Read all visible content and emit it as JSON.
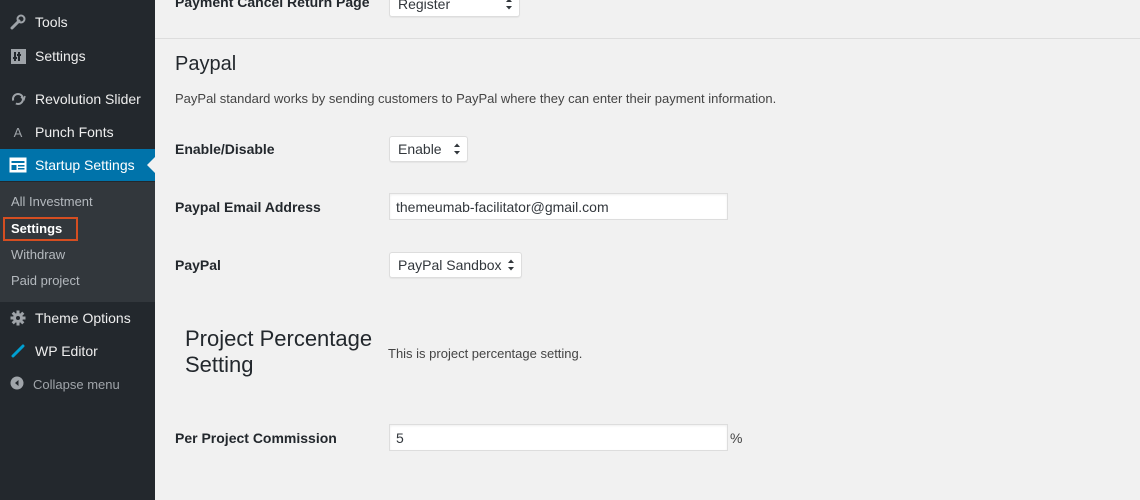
{
  "sidebar": {
    "menu": [
      {
        "label": "Tools",
        "icon": "wrench-icon"
      },
      {
        "label": "Settings",
        "icon": "settings-icon"
      },
      {
        "label": "Revolution Slider",
        "icon": "refresh-icon"
      },
      {
        "label": "Punch Fonts",
        "icon": "font-icon"
      },
      {
        "label": "Startup Settings",
        "icon": "window-icon"
      },
      {
        "label": "Theme Options",
        "icon": "gear-icon"
      },
      {
        "label": "WP Editor",
        "icon": "pencil-icon"
      }
    ],
    "submenu": [
      "All Investment",
      "Settings",
      "Withdraw",
      "Paid project"
    ],
    "collapse_label": "Collapse menu",
    "accent_color": "#0073aa",
    "highlight_color": "#d54e21"
  },
  "main": {
    "cancel_return": {
      "label": "Payment Cancel Return Page",
      "value": "Register"
    },
    "paypal": {
      "title": "Paypal",
      "description": "PayPal standard works by sending customers to PayPal where they can enter their payment information.",
      "enable": {
        "label": "Enable/Disable",
        "value": "Enable"
      },
      "email": {
        "label": "Paypal Email Address",
        "value": "themeumab-facilitator@gmail.com"
      },
      "mode": {
        "label": "PayPal",
        "value": "PayPal Sandbox"
      }
    },
    "percentage": {
      "title": "Project Percentage Setting",
      "description": "This is project percentage setting.",
      "commission": {
        "label": "Per Project Commission",
        "value": "5",
        "unit": "%"
      }
    }
  }
}
